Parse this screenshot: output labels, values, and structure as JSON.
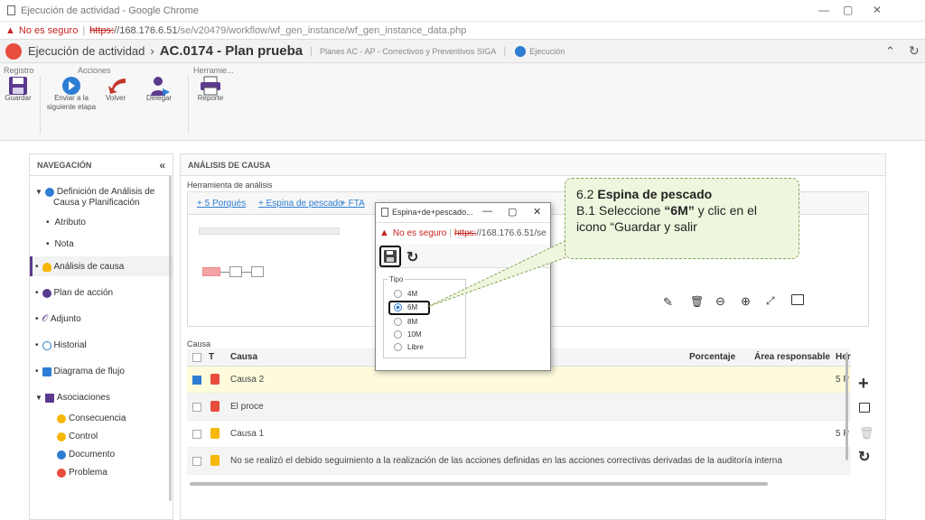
{
  "window": {
    "title": "Ejecución de actividad - Google Chrome"
  },
  "url": {
    "not_secure": "No es seguro",
    "scheme": "https:",
    "host": "//168.176.6.51",
    "path": "/se/v20479/workflow/wf_gen_instance/wf_gen_instance_data.php"
  },
  "header": {
    "title_a": "Ejecución de actividad",
    "sep": "›",
    "title_b": "AC.0174 - Plan prueba",
    "subtitle": "Planes AC - AP - Correctivos y Preventivos SIGA",
    "status": "Ejecución"
  },
  "toolbar": {
    "groups": {
      "registro": "Registro",
      "acciones": "Acciones",
      "herramientas": "Herramie..."
    },
    "guardar": "Guardar",
    "enviar": "Enviar a la siguiente etapa",
    "volver": "Volver",
    "delegar": "Delegar",
    "reporte": "Reporte"
  },
  "nav": {
    "title": "NAVEGACIÓN",
    "collapse": "«",
    "items": [
      {
        "label": "Definición de Análisis de"
      },
      {
        "label": "Causa y Planificación"
      },
      {
        "label": "Atributo"
      },
      {
        "label": "Nota"
      },
      {
        "label": "Análisis de causa"
      },
      {
        "label": "Plan de acción"
      },
      {
        "label": "Adjunto"
      },
      {
        "label": "Historial"
      },
      {
        "label": "Diagrama de flujo"
      },
      {
        "label": "Asociaciones"
      },
      {
        "label": "Consecuencia"
      },
      {
        "label": "Control"
      },
      {
        "label": "Documento"
      },
      {
        "label": "Problema"
      }
    ]
  },
  "main": {
    "section": "ANÁLISIS DE CAUSA",
    "tool_label": "Herramienta de análisis",
    "tabs": [
      "+ 5 Porqués",
      "+ Espina de pescado",
      "+ FTA",
      "+ ..."
    ],
    "causa_label": "Causa",
    "columns": {
      "t": "T",
      "causa": "Causa",
      "porcentaje": "Porcentaje",
      "area": "Área responsable",
      "her": "Her"
    },
    "rows": [
      {
        "text": "Causa 2",
        "checked": true,
        "her": "5 P"
      },
      {
        "text": "El proce",
        "checked": false,
        "her": ""
      },
      {
        "text": "Causa 1",
        "checked": false,
        "her": "5 P"
      },
      {
        "text": "No se realizó el debido seguimiento a la realización de las acciones definidas en las acciones correctivas derivadas de la auditoría interna",
        "checked": false,
        "her": ""
      }
    ]
  },
  "popup": {
    "title": "Espina+de+pescado...",
    "not_secure": "No es seguro",
    "url_scheme": "https:",
    "url_rest": "//168.176.6.51/se",
    "tipo_label": "Tipo",
    "options": [
      "4M",
      "6M",
      "8M",
      "10M",
      "Libre"
    ],
    "selected": "6M"
  },
  "callout": {
    "step": "6.2 ",
    "step_bold": "Espina de pescado",
    "line2_a": "B.1 Seleccione ",
    "line2_b": "“6M”",
    "line2_c": " y clic en el",
    "line3": "icono “Guardar y salir"
  },
  "colors": {
    "accent": "#2d7dd2",
    "red": "#e74c3c",
    "callout_bg": "#eef7de",
    "row_highlight": "#fdfbdc"
  }
}
